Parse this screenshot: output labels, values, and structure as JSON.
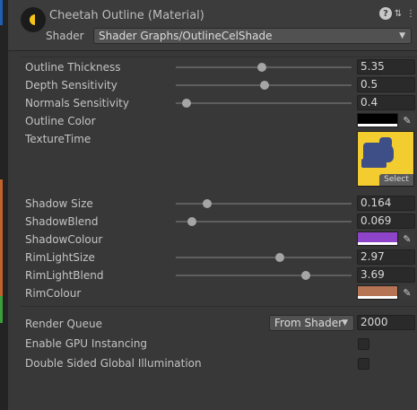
{
  "window": {
    "title": "Cheetah Outline (Material)",
    "help_icon": "help-icon",
    "settings_icon": "sliders-icon",
    "menu_icon": "kebab-menu-icon"
  },
  "shader": {
    "label": "Shader",
    "value": "Shader Graphs/OutlineCelShade"
  },
  "properties": {
    "outline_thickness": {
      "label": "Outline Thickness",
      "value": "5.35",
      "slider_fraction": 0.5
    },
    "depth_sensitivity": {
      "label": "Depth Sensitivity",
      "value": "0.5",
      "slider_fraction": 0.5
    },
    "normals_sensitivity": {
      "label": "Normals Sensitivity",
      "value": "0.4",
      "slider_fraction": 0.06
    },
    "outline_color": {
      "label": "Outline Color",
      "color": "#000000"
    },
    "texture_time": {
      "label": "TextureTime",
      "select_label": "Select"
    },
    "shadow_size": {
      "label": "Shadow Size",
      "value": "0.164",
      "slider_fraction": 0.18
    },
    "shadow_blend": {
      "label": "ShadowBlend",
      "value": "0.069",
      "slider_fraction": 0.09
    },
    "shadow_colour": {
      "label": "ShadowColour",
      "color": "#8e44c8"
    },
    "rim_light_size": {
      "label": "RimLightSize",
      "value": "2.97",
      "slider_fraction": 0.59
    },
    "rim_light_blend": {
      "label": "RimLightBlend",
      "value": "3.69",
      "slider_fraction": 0.74
    },
    "rim_colour": {
      "label": "RimColour",
      "color": "#b57454"
    }
  },
  "render_queue": {
    "label": "Render Queue",
    "mode": "From Shader",
    "value": "2000"
  },
  "enable_gpu_instancing": {
    "label": "Enable GPU Instancing",
    "checked": false
  },
  "double_sided_gi": {
    "label": "Double Sided Global Illumination",
    "checked": false
  }
}
